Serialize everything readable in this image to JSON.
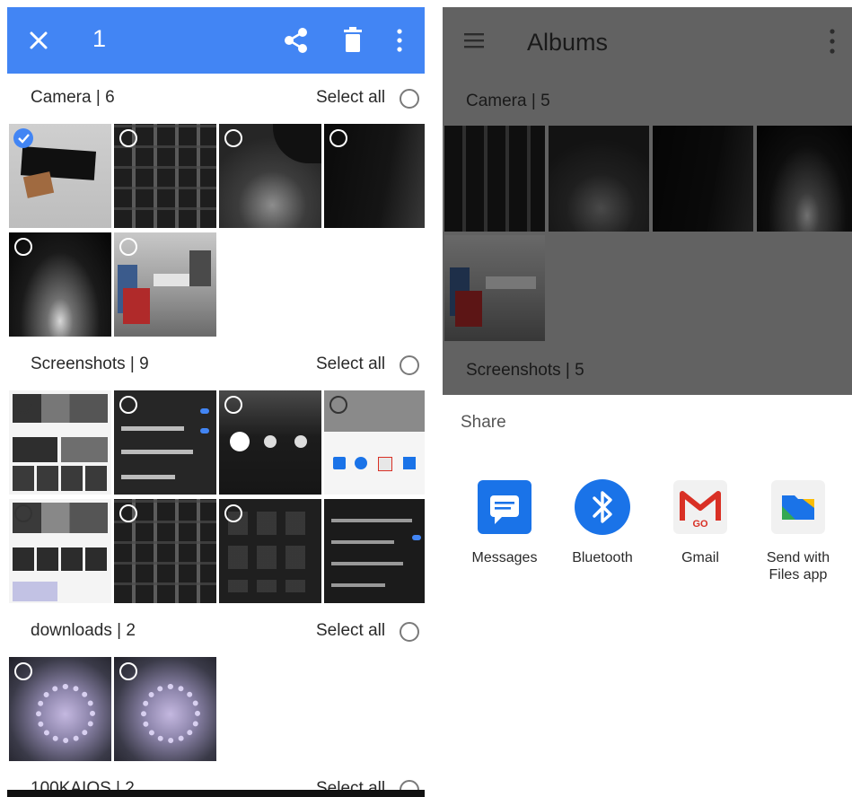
{
  "selection_bar": {
    "count": "1",
    "icons": [
      "close-icon",
      "share-icon",
      "trash-icon",
      "more-vert-icon"
    ],
    "color": "#4285f4"
  },
  "sections": [
    {
      "title": "Camera | 6",
      "select_all": "Select all",
      "photos": 6,
      "selected": [
        0
      ]
    },
    {
      "title": "Screenshots | 9",
      "select_all": "Select all",
      "photos": 8
    },
    {
      "title": "downloads | 2",
      "select_all": "Select all",
      "photos": 2
    },
    {
      "title": "100KAIOS | 2",
      "select_all": "Select all"
    }
  ],
  "albums": {
    "title": "Albums",
    "sections": [
      "Camera | 5",
      "Screenshots | 5"
    ]
  },
  "share": {
    "label": "Share",
    "apps": [
      {
        "label": "Messages",
        "icon": "messages-icon",
        "color": "#1a73e8"
      },
      {
        "label": "Bluetooth",
        "icon": "bluetooth-icon",
        "color": "#1a73e8"
      },
      {
        "label": "Gmail",
        "icon": "gmail-icon",
        "color": "#d93025",
        "badge": "GO"
      },
      {
        "label": "Send with\nFiles app",
        "icon": "files-app-icon",
        "color": "#1a73e8"
      }
    ]
  }
}
